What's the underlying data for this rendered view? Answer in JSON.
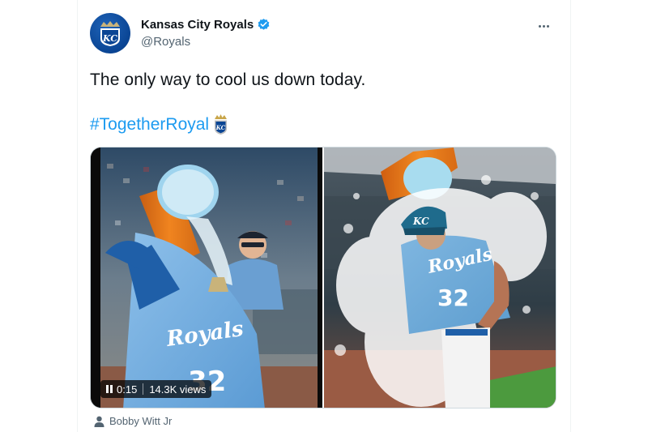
{
  "tweet": {
    "display_name": "Kansas City Royals",
    "handle": "@Royals",
    "text": "The only way to cool us down today.",
    "hashtag": "#TogetherRoyal",
    "verified": true,
    "colors": {
      "accent": "#1d9bf0",
      "royals_blue": "#0a4594",
      "powder_blue": "#6aa9dd"
    }
  },
  "media": {
    "left": {
      "type": "video",
      "duration": "0:15",
      "views": "14.3K views",
      "jersey_number": "32",
      "jersey_script": "Royals"
    },
    "right": {
      "type": "photo",
      "jersey_number": "32",
      "jersey_script": "Royals",
      "cap_logo": "KC"
    }
  },
  "tagged": {
    "name": "Bobby Witt Jr"
  },
  "icons": [
    "royals-logo-icon",
    "verified-badge-icon",
    "more-icon",
    "kc-emoji-icon",
    "pause-icon",
    "person-icon"
  ]
}
